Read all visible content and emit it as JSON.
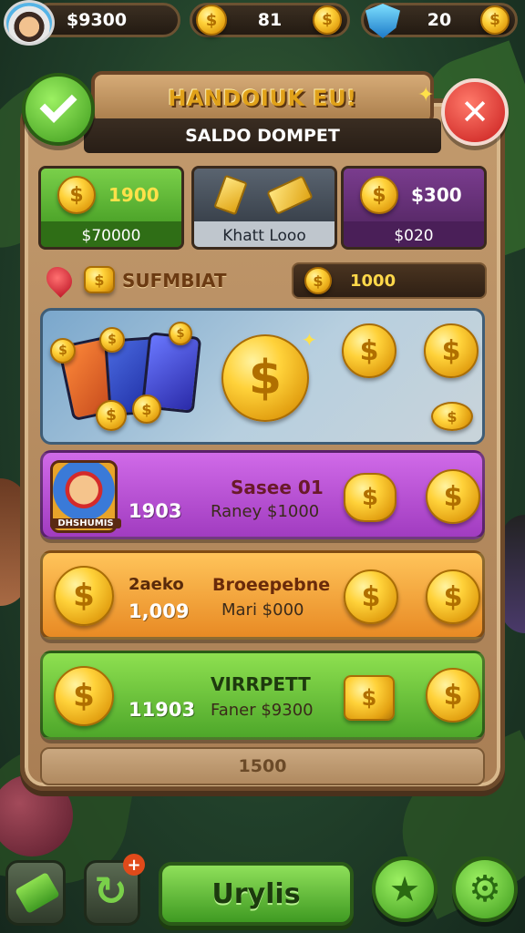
{
  "topbar": {
    "coins_value": "$9300",
    "gems_value": "81",
    "shields_value": "20"
  },
  "header": {
    "title": "HANDOIUK EU!",
    "subtitle": "SALDO DOMPET"
  },
  "stats": [
    {
      "value": "1900",
      "caption": "$70000"
    },
    {
      "value": "",
      "caption": "Khatt Looo"
    },
    {
      "value": "$300",
      "caption": "$020"
    }
  ],
  "label_row": {
    "label": "SUFMBIAT",
    "total": "1000"
  },
  "offers": [
    {
      "badge": "DHSHUMIS",
      "amount": "1903",
      "title": "Sasee 01",
      "subtitle": "Raney $1000"
    },
    {
      "amount": "1,009",
      "title_left": "2aeko",
      "title": "Broeepebne",
      "subtitle": "Mari $000"
    },
    {
      "amount": "11903",
      "title": "VIRRPETT",
      "subtitle": "Faner $9300"
    }
  ],
  "bottom_strip": "1500",
  "nav": {
    "main_label": "Urylis"
  },
  "colors": {
    "green": "#4caa2a",
    "purple": "#9a3cb5",
    "orange": "#f0a035",
    "gold": "#ffd23a",
    "close_red": "#d82a2a"
  }
}
